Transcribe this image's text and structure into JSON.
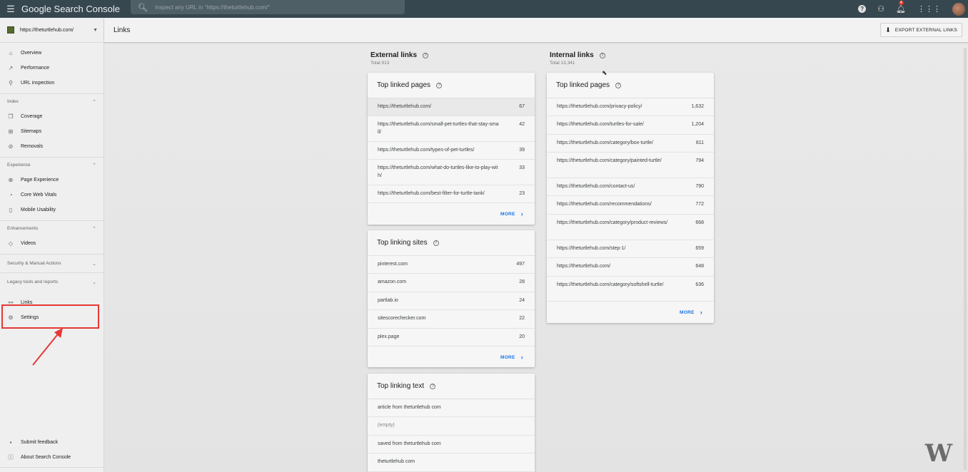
{
  "topbar": {
    "app_name": "Google Search Console",
    "search_placeholder": "Inspect any URL in \"https://theturtlehub.com/\"",
    "notification_count": "4"
  },
  "sidebar": {
    "property": "https://theturtlehub.com/",
    "top_items": [
      {
        "label": "Overview",
        "icon": "home-icon"
      },
      {
        "label": "Performance",
        "icon": "trending-up-icon"
      },
      {
        "label": "URL inspection",
        "icon": "search-icon"
      }
    ],
    "sections": [
      {
        "label": "Index",
        "items": [
          {
            "label": "Coverage",
            "icon": "file-copy-icon"
          },
          {
            "label": "Sitemaps",
            "icon": "sitemap-icon"
          },
          {
            "label": "Removals",
            "icon": "eye-off-icon"
          }
        ]
      },
      {
        "label": "Experience",
        "items": [
          {
            "label": "Page Experience",
            "icon": "add-circle-icon"
          },
          {
            "label": "Core Web Vitals",
            "icon": "speed-icon"
          },
          {
            "label": "Mobile Usability",
            "icon": "phone-icon"
          }
        ]
      },
      {
        "label": "Enhancements",
        "items": [
          {
            "label": "Videos",
            "icon": "video-diamond-icon"
          }
        ]
      }
    ],
    "collapsed_sections": [
      "Security & Manual Actions",
      "Legacy tools and reports"
    ],
    "links_item": "Links",
    "settings_item": "Settings",
    "bottom_items": [
      "Submit feedback",
      "About Search Console"
    ]
  },
  "header": {
    "title": "Links",
    "export_label": "EXPORT EXTERNAL LINKS"
  },
  "external": {
    "title": "External links",
    "total": "Total 913",
    "top_linked_pages": {
      "title": "Top linked pages",
      "rows": [
        {
          "text": "https://theturtlehub.com/",
          "value": "67"
        },
        {
          "text": "https://theturtlehub.com/small-pet-turtles-that-stay-small/",
          "value": "42"
        },
        {
          "text": "https://theturtlehub.com/types-of-pet-turtles/",
          "value": "39"
        },
        {
          "text": "https://theturtlehub.com/what-do-turtles-like-to-play-with/",
          "value": "33"
        },
        {
          "text": "https://theturtlehub.com/best-filter-for-turtle-tank/",
          "value": "23"
        }
      ],
      "more": "MORE"
    },
    "top_linking_sites": {
      "title": "Top linking sites",
      "rows": [
        {
          "text": "pinterest.com",
          "value": "497"
        },
        {
          "text": "amazon.com",
          "value": "28"
        },
        {
          "text": "partlab.io",
          "value": "24"
        },
        {
          "text": "sitescorechecker.com",
          "value": "22"
        },
        {
          "text": "plex.page",
          "value": "20"
        }
      ],
      "more": "MORE"
    },
    "top_linking_text": {
      "title": "Top linking text",
      "rows": [
        {
          "text": "article from theturtlehub com",
          "value": ""
        },
        {
          "text": "(empty)",
          "value": ""
        },
        {
          "text": "saved from theturtlehub com",
          "value": ""
        },
        {
          "text": "theturtlehub com",
          "value": ""
        }
      ]
    }
  },
  "internal": {
    "title": "Internal links",
    "total": "Total 13,341",
    "top_linked_pages": {
      "title": "Top linked pages",
      "rows": [
        {
          "text": "https://theturtlehub.com/privacy-policy/",
          "value": "1,632"
        },
        {
          "text": "https://theturtlehub.com/turtles-for-sale/",
          "value": "1,204"
        },
        {
          "text": "https://theturtlehub.com/category/box-turtle/",
          "value": "811"
        },
        {
          "text": "https://theturtlehub.com/category/painted-turtle/",
          "value": "794"
        },
        {
          "text": "https://theturtlehub.com/contact-us/",
          "value": "790"
        },
        {
          "text": "https://theturtlehub.com/recommendations/",
          "value": "772"
        },
        {
          "text": "https://theturtlehub.com/category/product-reviews/",
          "value": "668"
        },
        {
          "text": "https://theturtlehub.com/step-1/",
          "value": "659"
        },
        {
          "text": "https://theturtlehub.com/",
          "value": "648"
        },
        {
          "text": "https://theturtlehub.com/category/softshell-turtle/",
          "value": "636"
        }
      ],
      "more": "MORE"
    }
  },
  "watermark": "W"
}
